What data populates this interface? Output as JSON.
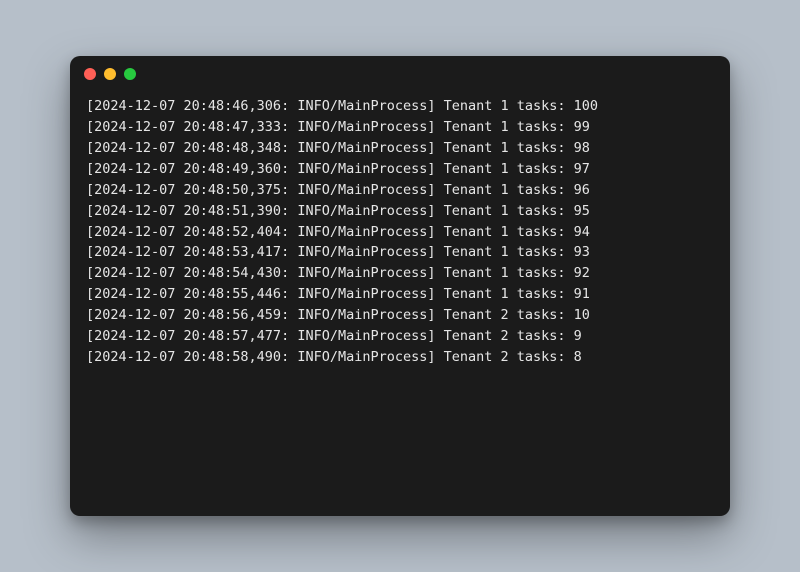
{
  "window": {
    "buttons": [
      "close",
      "minimize",
      "zoom"
    ]
  },
  "log_level": "INFO",
  "log_process": "MainProcess",
  "log": {
    "lines": [
      {
        "ts": "2024-12-07 20:48:46,306",
        "prefix": "[2024-12-07 20:48:46,306: INFO/MainProcess]",
        "msg": " Tenant 1 tasks: 100",
        "tenant": 1,
        "tasks": 100
      },
      {
        "ts": "2024-12-07 20:48:47,333",
        "prefix": "[2024-12-07 20:48:47,333: INFO/MainProcess]",
        "msg": " Tenant 1 tasks: 99",
        "tenant": 1,
        "tasks": 99
      },
      {
        "ts": "2024-12-07 20:48:48,348",
        "prefix": "[2024-12-07 20:48:48,348: INFO/MainProcess]",
        "msg": " Tenant 1 tasks: 98",
        "tenant": 1,
        "tasks": 98
      },
      {
        "ts": "2024-12-07 20:48:49,360",
        "prefix": "[2024-12-07 20:48:49,360: INFO/MainProcess]",
        "msg": " Tenant 1 tasks: 97",
        "tenant": 1,
        "tasks": 97
      },
      {
        "ts": "2024-12-07 20:48:50,375",
        "prefix": "[2024-12-07 20:48:50,375: INFO/MainProcess]",
        "msg": " Tenant 1 tasks: 96",
        "tenant": 1,
        "tasks": 96
      },
      {
        "ts": "2024-12-07 20:48:51,390",
        "prefix": "[2024-12-07 20:48:51,390: INFO/MainProcess]",
        "msg": " Tenant 1 tasks: 95",
        "tenant": 1,
        "tasks": 95
      },
      {
        "ts": "2024-12-07 20:48:52,404",
        "prefix": "[2024-12-07 20:48:52,404: INFO/MainProcess]",
        "msg": " Tenant 1 tasks: 94",
        "tenant": 1,
        "tasks": 94
      },
      {
        "ts": "2024-12-07 20:48:53,417",
        "prefix": "[2024-12-07 20:48:53,417: INFO/MainProcess]",
        "msg": " Tenant 1 tasks: 93",
        "tenant": 1,
        "tasks": 93
      },
      {
        "ts": "2024-12-07 20:48:54,430",
        "prefix": "[2024-12-07 20:48:54,430: INFO/MainProcess]",
        "msg": " Tenant 1 tasks: 92",
        "tenant": 1,
        "tasks": 92
      },
      {
        "ts": "2024-12-07 20:48:55,446",
        "prefix": "[2024-12-07 20:48:55,446: INFO/MainProcess]",
        "msg": " Tenant 1 tasks: 91",
        "tenant": 1,
        "tasks": 91
      },
      {
        "ts": "2024-12-07 20:48:56,459",
        "prefix": "[2024-12-07 20:48:56,459: INFO/MainProcess]",
        "msg": " Tenant 2 tasks: 10",
        "tenant": 2,
        "tasks": 10
      },
      {
        "ts": "2024-12-07 20:48:57,477",
        "prefix": "[2024-12-07 20:48:57,477: INFO/MainProcess]",
        "msg": " Tenant 2 tasks: 9",
        "tenant": 2,
        "tasks": 9
      },
      {
        "ts": "2024-12-07 20:48:58,490",
        "prefix": "[2024-12-07 20:48:58,490: INFO/MainProcess]",
        "msg": " Tenant 2 tasks: 8",
        "tenant": 2,
        "tasks": 8
      }
    ]
  }
}
